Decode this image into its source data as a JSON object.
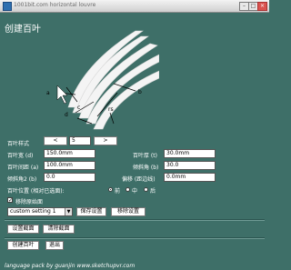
{
  "window": {
    "title": "1001bit.com horizontal louvre",
    "title_display": "1001bit.com horizontal louvre",
    "heading": "创建百叶"
  },
  "diagram": {
    "labels": {
      "a": "a",
      "b": "b",
      "d": "d",
      "c": "c",
      "rs": "rs"
    }
  },
  "type": {
    "label": "百叶样式",
    "prev_label": "<",
    "value": "5",
    "next_label": ">"
  },
  "fields": {
    "width": {
      "label": "百叶宽 (d)",
      "value": "150.0mm"
    },
    "thick": {
      "label": "百叶厚 (t)",
      "value": "30.0mm"
    },
    "spacing": {
      "label": "百叶间距 (a)",
      "value": "100.0mm"
    },
    "angle": {
      "label": "倾斜角 (b)",
      "value": "30.0"
    },
    "tilt2": {
      "label": "倾斜角2 (b)",
      "value": "0.0"
    },
    "offset": {
      "label": "偏移 (距边线)",
      "value": "0.0mm"
    }
  },
  "position": {
    "label": "百叶位置 (相对已选面):",
    "options": [
      "前",
      "中",
      "后"
    ],
    "selected": 0
  },
  "remove_base": {
    "label": "移除原始面",
    "checked": true
  },
  "preset": {
    "value": "custom setting 1",
    "save_label": "保存设置",
    "delete_label": "移除设置"
  },
  "section_buttons": {
    "set_label": "设置截面",
    "clear_label": "清除截面"
  },
  "actions": {
    "create_label": "创建百叶",
    "exit_label": "退出"
  },
  "footer": {
    "text": "language pack by guanjin    www.sketchupvr.com"
  }
}
